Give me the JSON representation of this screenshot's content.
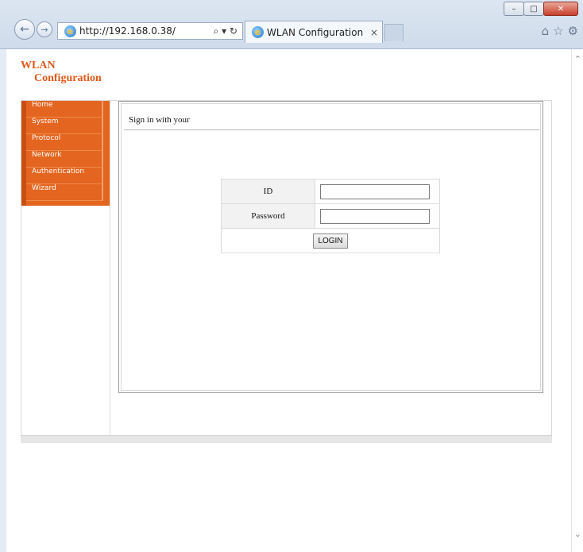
{
  "browser": {
    "address": "http://192.168.0.38/",
    "address_tools": "⌕ ▾ ↻",
    "tab_title": "WLAN Configuration",
    "tab_close": "×",
    "window_buttons": {
      "minimize": "–",
      "maximize": "□",
      "close": "✕"
    },
    "right_icons": {
      "home": "⌂",
      "favorites": "☆",
      "settings": "⚙"
    }
  },
  "page": {
    "title_line1": "WLAN",
    "title_line2": "Configuration",
    "colors": {
      "accent": "#e05a1a",
      "menu_bg": "#e3651f"
    }
  },
  "menu": {
    "items": [
      {
        "label": "Home"
      },
      {
        "label": "System"
      },
      {
        "label": "Protocol"
      },
      {
        "label": "Network"
      },
      {
        "label": "Authentication"
      },
      {
        "label": "Wizard"
      }
    ]
  },
  "login": {
    "heading": "Sign in with your",
    "id_label": "ID",
    "id_value": "",
    "password_label": "Password",
    "password_value": "",
    "button_label": "LOGIN"
  }
}
